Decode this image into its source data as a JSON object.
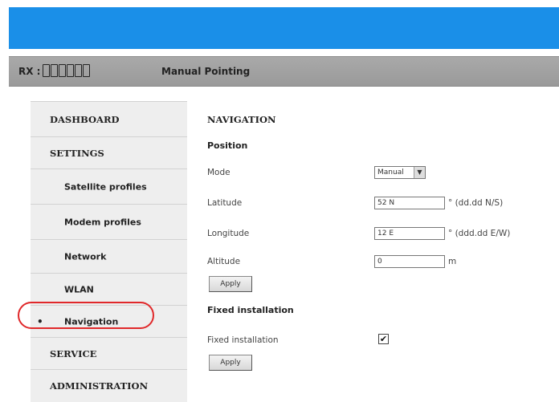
{
  "header": {
    "rx_label": "RX :",
    "rx_bar_count": 6,
    "page_title": "Manual Pointing",
    "accent_color": "#1a8fe8"
  },
  "sidebar": {
    "items": [
      {
        "label": "DASHBOARD",
        "level": "top"
      },
      {
        "label": "SETTINGS",
        "level": "top"
      },
      {
        "label": "Satellite profiles",
        "level": "sub"
      },
      {
        "label": "Modem profiles",
        "level": "sub"
      },
      {
        "label": "Network",
        "level": "sub"
      },
      {
        "label": "WLAN",
        "level": "sub"
      },
      {
        "label": "Navigation",
        "level": "sub",
        "active": true,
        "bullet": "•"
      },
      {
        "label": "SERVICE",
        "level": "top"
      },
      {
        "label": "ADMINISTRATION",
        "level": "top"
      }
    ],
    "highlight_color": "#e0282a"
  },
  "content": {
    "title": "NAVIGATION",
    "position": {
      "heading": "Position",
      "mode": {
        "label": "Mode",
        "value": "Manual",
        "arrow": "▼"
      },
      "latitude": {
        "label": "Latitude",
        "value": "52 N",
        "unit": "° (dd.dd N/S)"
      },
      "longitude": {
        "label": "Longitude",
        "value": "12 E",
        "unit": "° (ddd.dd E/W)"
      },
      "altitude": {
        "label": "Altitude",
        "value": "0",
        "unit": "m"
      },
      "apply_label": "Apply"
    },
    "fixed": {
      "heading": "Fixed installation",
      "label": "Fixed installation",
      "checked": true,
      "check_mark": "✔",
      "apply_label": "Apply"
    }
  }
}
